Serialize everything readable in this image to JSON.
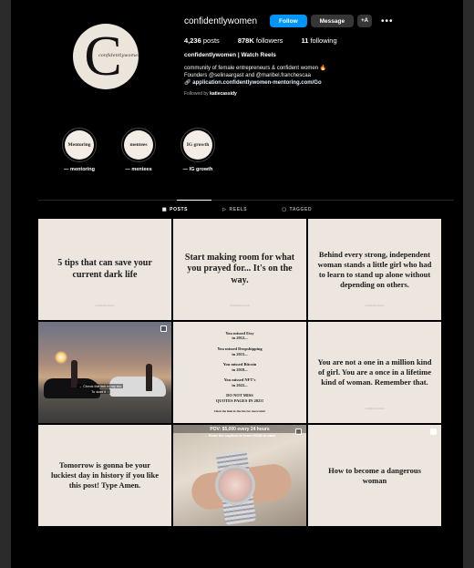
{
  "profile": {
    "username": "confidentlywomen",
    "follow_label": "Follow",
    "message_label": "Message",
    "add_label": "+A",
    "more_label": "•••",
    "posts_count": "4,236",
    "posts_label": "posts",
    "followers_count": "878K",
    "followers_label": "followers",
    "following_count": "11",
    "following_label": "following",
    "full_name": "confidentlywomen | Watch Reels",
    "bio_line1": "community of female entrepreneurs & confident women 🔥",
    "bio_line2": "Founders @selinaargast and @maribel.franchescaa",
    "bio_link": "application.confidentlywomen-mentoring.com/Go",
    "followed_prefix": "Followed by",
    "followed_by": "katiecassidy",
    "avatar_letter": "C",
    "avatar_script": "confidentlywomen"
  },
  "highlights": [
    {
      "cover": "Mentoring",
      "label": "— mentoring"
    },
    {
      "cover": "mentees",
      "label": "— mentees"
    },
    {
      "cover": "IG growth",
      "label": "— IG growth"
    }
  ],
  "tabs": [
    {
      "icon": "▦",
      "label": "POSTS",
      "active": true
    },
    {
      "icon": "▷",
      "label": "REELS",
      "active": false
    },
    {
      "icon": "▢",
      "label": "TAGGED",
      "active": false
    }
  ],
  "posts": {
    "p1": "5 tips that can save your current dark life",
    "p2": "Start making room for what you prayed for... It's on the way.",
    "p3": "Behind every strong, independent woman stands a little girl who had to learn to stand up alone without depending on others.",
    "p4_caption1": "→ Check the link in my bio",
    "p4_caption2": "To start it ↓",
    "p5": {
      "l1": "You missed Etsy",
      "l2": "in 2012...",
      "l3": "You missed Dropshipping",
      "l4": "in 2015...",
      "l5": "You missed Bitcoin",
      "l6": "in 2018...",
      "l7": "You missed NFT's",
      "l8": "in 2022...",
      "l9": "DO NOT MISS",
      "l10": "QUOTES PAGES IN 2023!",
      "l11": "Click the link in the bio for more info!"
    },
    "p6": "You are not a one in a million kind of girl. You are a once in a lifetime kind of woman. Remember that.",
    "p7": "Tomorrow is gonna be your luckiest day in history if you like this post! Type Amen.",
    "p8_banner": "POV: $5,000 every 24 hours",
    "p8_sub": "→ Read the caption to learn HOW to start",
    "p9": "How to become a dangerous woman",
    "watermark": "confidentlywomen"
  },
  "colors": {
    "accent": "#0095f6",
    "background": "#000000",
    "post_bg": "#ece6df"
  }
}
